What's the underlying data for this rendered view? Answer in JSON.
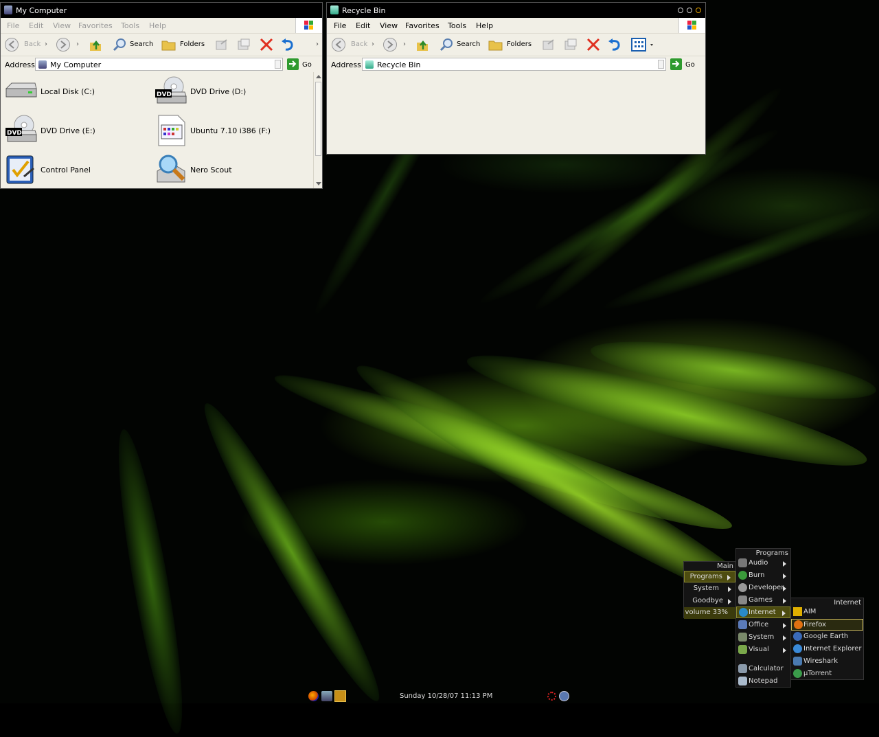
{
  "my_computer": {
    "title": "My Computer",
    "menu": [
      "File",
      "Edit",
      "View",
      "Favorites",
      "Tools",
      "Help"
    ],
    "toolbar": {
      "back": "Back",
      "search": "Search",
      "folders": "Folders"
    },
    "address_label": "Address",
    "address_value": "My Computer",
    "go": "Go",
    "items": [
      {
        "label": "Local Disk (C:)",
        "icon": "hard-disk-icon"
      },
      {
        "label": "DVD Drive (D:)",
        "icon": "dvd-drive-icon"
      },
      {
        "label": "DVD Drive (E:)",
        "icon": "dvd-drive-icon"
      },
      {
        "label": "Ubuntu 7.10 i386 (F:)",
        "icon": "cd-image-icon"
      },
      {
        "label": "Control Panel",
        "icon": "control-panel-icon"
      },
      {
        "label": "Nero Scout",
        "icon": "nero-scout-icon"
      }
    ]
  },
  "recycle_bin": {
    "title": "Recycle Bin",
    "menu": [
      "File",
      "Edit",
      "View",
      "Favorites",
      "Tools",
      "Help"
    ],
    "toolbar": {
      "back": "Back",
      "search": "Search",
      "folders": "Folders"
    },
    "address_label": "Address",
    "address_value": "Recycle Bin",
    "go": "Go"
  },
  "desktop_menu": {
    "main": {
      "title": "Main",
      "items": [
        "Programs",
        "System",
        "Goodbye"
      ],
      "volume": "volume 33%"
    },
    "programs": {
      "title": "Programs",
      "items": [
        "Audio",
        "Burn",
        "Developer",
        "Games",
        "Internet",
        "Office",
        "System",
        "Visual"
      ],
      "extras": [
        "Calculator",
        "Notepad"
      ]
    },
    "internet": {
      "title": "Internet",
      "items": [
        "AIM",
        "Firefox",
        "Google Earth",
        "Internet Explorer",
        "Wireshark",
        "µTorrent"
      ]
    }
  },
  "taskbar": {
    "clock": "Sunday 10/28/07 11:13 PM"
  },
  "colors": {
    "highlight": "#4d4c10",
    "go_green": "#2e9a2e",
    "menu_bg": "#141414"
  }
}
